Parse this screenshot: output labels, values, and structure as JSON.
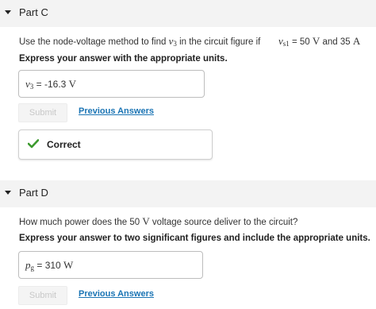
{
  "part_c": {
    "title": "Part C",
    "prompt_prefix": "Use the node-voltage method to find ",
    "prompt_var": "v",
    "prompt_var_sub": "3",
    "prompt_mid": " in the circuit figure if",
    "cond_var": "v",
    "cond_var_sub": "s1",
    "cond_eq": " = 50 ",
    "cond_unit1": "V",
    "cond_and": " and 35 ",
    "cond_unit2": "A",
    "instruction": "Express your answer with the appropriate units.",
    "answer": {
      "var": "v",
      "var_sub": "3",
      "eq": " = ",
      "value": "-16.3 ",
      "unit": "V"
    },
    "submit_label": "Submit",
    "previous_answers_label": "Previous Answers",
    "feedback": "Correct"
  },
  "part_d": {
    "title": "Part D",
    "prompt_prefix": "How much power does the 50 ",
    "prompt_unit": "V",
    "prompt_suffix": " voltage source deliver to the circuit?",
    "instruction": "Express your answer to two significant figures and include the appropriate units.",
    "answer": {
      "var": "p",
      "var_sub": "g",
      "eq": " = ",
      "value": "310 ",
      "unit": "W"
    },
    "submit_label": "Submit",
    "previous_answers_label": "Previous Answers"
  },
  "colors": {
    "link": "#1a74b4",
    "correct_check": "#3c9a2e",
    "header_bg": "#f3f3f3"
  },
  "icons": {
    "collapse": "caret-down-icon",
    "feedback": "checkmark-icon"
  }
}
